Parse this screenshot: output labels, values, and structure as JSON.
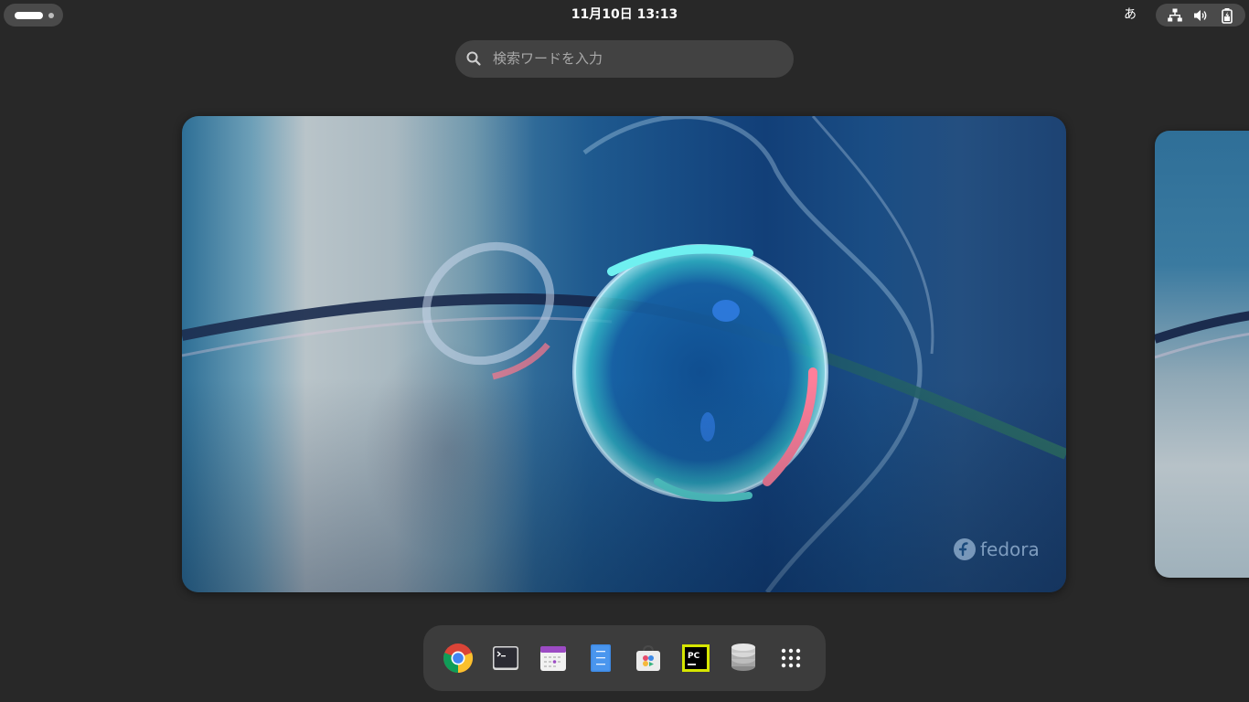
{
  "topbar": {
    "clock": "11月10日  13:13",
    "input_method": "あ",
    "status_icons": [
      "network-wired-icon",
      "volume-icon",
      "battery-charging-icon"
    ]
  },
  "search": {
    "placeholder": "検索ワードを入力"
  },
  "workspace": {
    "watermark": "fedora"
  },
  "dash": {
    "apps": [
      {
        "name": "Google Chrome",
        "icon": "chrome-icon"
      },
      {
        "name": "Terminal",
        "icon": "terminal-icon"
      },
      {
        "name": "Calendar",
        "icon": "calendar-icon"
      },
      {
        "name": "Text Editor",
        "icon": "text-editor-icon"
      },
      {
        "name": "Software",
        "icon": "software-store-icon"
      },
      {
        "name": "PyCharm",
        "icon": "pycharm-icon"
      },
      {
        "name": "Database",
        "icon": "database-icon"
      },
      {
        "name": "Show Applications",
        "icon": "app-grid-icon"
      }
    ]
  },
  "colors": {
    "background": "#282828",
    "panel_pill": "#4a4a4a",
    "search_bg": "#424242",
    "dash_bg": "#3c3c3c"
  }
}
